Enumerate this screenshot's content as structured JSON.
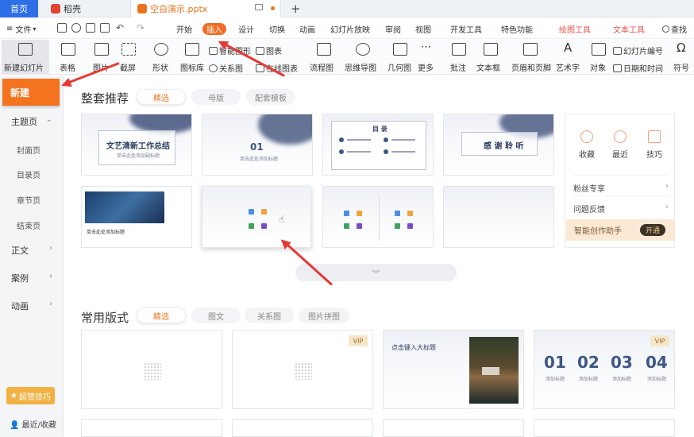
{
  "tabs": {
    "home": "首页",
    "daoke": "稻壳",
    "file": "空白演示.pptx",
    "add": "+"
  },
  "menu": {
    "hamburger": "≡",
    "file": "文件",
    "items": [
      "开始",
      "插入",
      "设计",
      "切换",
      "动画",
      "幻灯片放映",
      "审阅",
      "视图",
      "开发工具",
      "特色功能"
    ],
    "drawing_tools": "绘图工具",
    "text_tools": "文本工具",
    "search": "查找",
    "active": "插入"
  },
  "ribbon": {
    "new_slide": "新建幻灯片",
    "table": "表格",
    "picture": "图片",
    "screenshot": "截屏",
    "shape": "形状",
    "icon_lib": "图标库",
    "smart_graphic": "智能图形",
    "chart": "图表",
    "relation": "关系图",
    "online_chart": "在线图表",
    "flowchart": "流程图",
    "mindmap": "思维导图",
    "geometry": "几何图",
    "more": "更多",
    "comment": "批注",
    "textbox": "文本框",
    "header_footer": "页眉和页脚",
    "wordart": "艺术字",
    "object": "对象",
    "slide_number": "幻灯片编号",
    "datetime": "日期和时间",
    "symbol": "符号"
  },
  "sidebar": {
    "new": "新建",
    "theme": "主题页",
    "cover": "封面页",
    "toc": "目录页",
    "chapter": "章节页",
    "end": "结束页",
    "body": "正文",
    "case": "案例",
    "animation": "动画",
    "tips": "超赞技巧",
    "recent": "最近/收藏"
  },
  "section1": {
    "title": "整套推荐",
    "pills": [
      "精选",
      "母版",
      "配套模板"
    ],
    "thumb_titles": {
      "t1": "文艺清新工作总结",
      "t1_sub": "单击此处添加副标题",
      "t2_num": "01",
      "t2_sub": "单击此处添加标题",
      "t3": "目 录",
      "t4": "感 谢 聆 听",
      "t5": "单击此处添加标题"
    }
  },
  "sidecard": {
    "favorite": "收藏",
    "recent": "最近",
    "tips": "技巧",
    "fans": "粉丝专享",
    "feedback": "问题反馈",
    "ai": "智能创作助手",
    "open": "开通"
  },
  "section2": {
    "title": "常用版式",
    "pills": [
      "精选",
      "图文",
      "关系图",
      "图片拼图"
    ],
    "vip": "VIP",
    "t3_title": "点击键入大标题",
    "t4_nums": [
      "01",
      "02",
      "03",
      "04"
    ],
    "t4_sub": "添加标题"
  },
  "expand_icon": "chevron-double-down-icon",
  "colors": {
    "accent": "#f3731f",
    "blue_tab": "#2e6fe8",
    "arrow": "#e53935"
  }
}
